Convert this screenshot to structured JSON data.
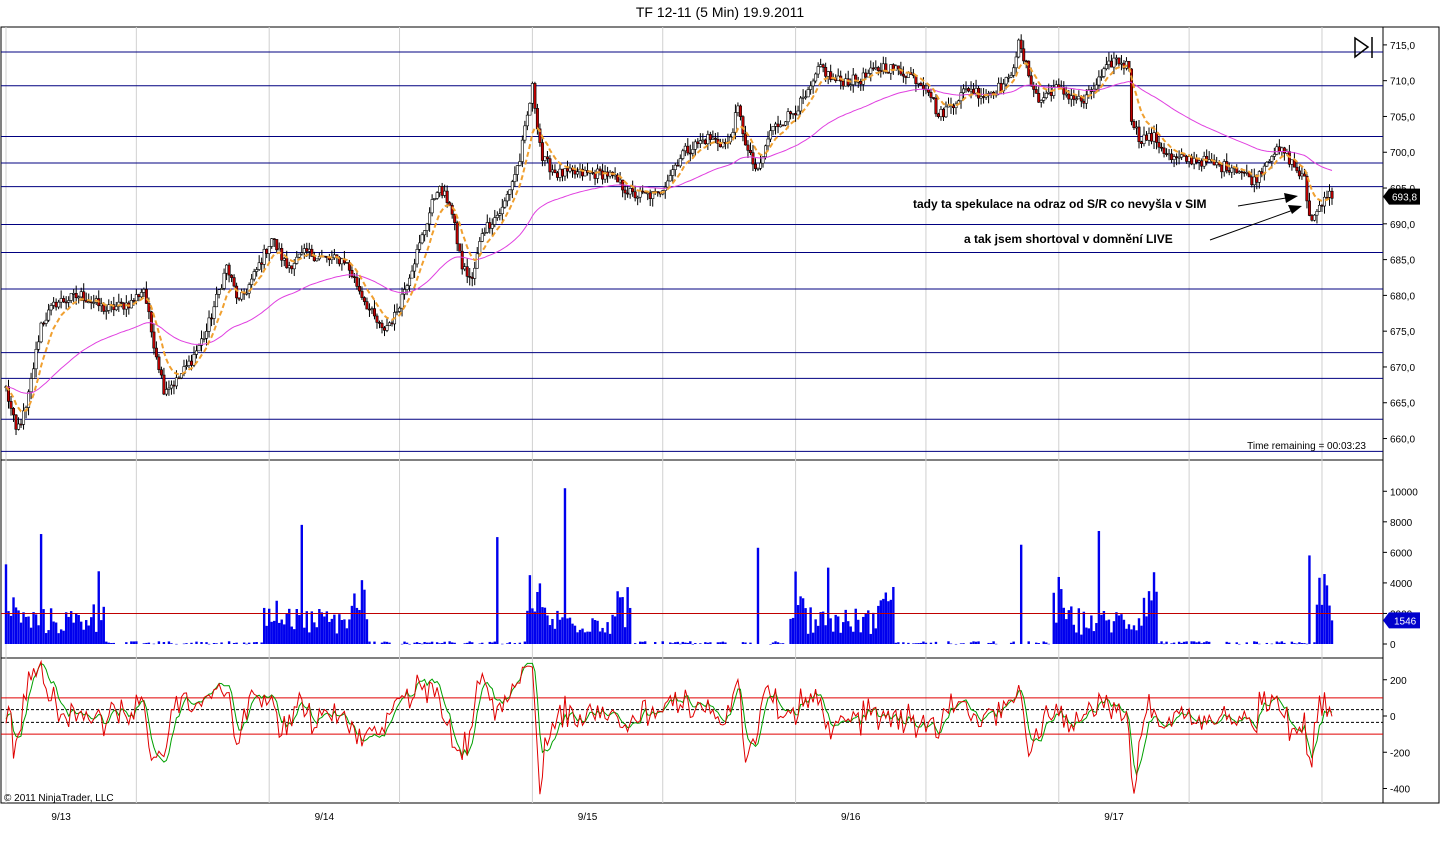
{
  "window": {
    "title": "TF 12-11 (5 Min)  19.9.2011"
  },
  "copyright": "© 2011 NinjaTrader, LLC",
  "time_remaining": "Time remaining = 00:03:23",
  "annotations": [
    "tady ta spekulace na odraz od S/R co nevyšla v SIM",
    "a tak jsem shortoval v domnění LIVE"
  ],
  "x_tick_labels": [
    "9/13",
    "9/14",
    "9/15",
    "9/16",
    "9/17"
  ],
  "colors": {
    "candle_up": "#ffffff",
    "candle_down": "#c00000",
    "ema_fast": "#f0a030",
    "sma_slow": "#e040e0",
    "volume": "#0000ee",
    "volume_level": "#c00000",
    "sr_line": "#000080",
    "osc_red": "#e00000",
    "osc_green": "#00a000",
    "price_marker": "#000000",
    "volume_marker": "#0000cc"
  },
  "chart_data": [
    {
      "type": "candlestick",
      "panel": "price",
      "y_tick_labels": [
        "715,0",
        "710,0",
        "705,0",
        "700,0",
        "695,0",
        "690,0",
        "685,0",
        "680,0",
        "675,0",
        "670,0",
        "665,0",
        "660,0"
      ],
      "y_ticks": [
        715,
        710,
        705,
        700,
        695,
        690,
        685,
        680,
        675,
        670,
        665,
        660
      ],
      "ylim": [
        657,
        717.5
      ],
      "last_price": 693.8,
      "last_price_label": "693,8",
      "sr_levels": [
        714.0,
        709.3,
        702.2,
        698.5,
        695.2,
        689.9,
        686.0,
        680.9,
        672.0,
        668.4,
        662.7,
        658.2
      ],
      "anchors": [
        [
          0,
          667
        ],
        [
          4,
          661
        ],
        [
          8,
          664
        ],
        [
          14,
          676
        ],
        [
          20,
          679
        ],
        [
          30,
          680
        ],
        [
          40,
          678
        ],
        [
          50,
          679
        ],
        [
          55,
          681
        ],
        [
          58,
          675
        ],
        [
          63,
          667
        ],
        [
          68,
          668
        ],
        [
          74,
          671
        ],
        [
          80,
          675
        ],
        [
          88,
          684
        ],
        [
          93,
          679
        ],
        [
          98,
          682
        ],
        [
          106,
          688
        ],
        [
          112,
          684
        ],
        [
          120,
          686
        ],
        [
          128,
          685
        ],
        [
          135,
          685
        ],
        [
          145,
          678
        ],
        [
          150,
          675
        ],
        [
          155,
          677
        ],
        [
          160,
          682
        ],
        [
          165,
          687
        ],
        [
          172,
          695
        ],
        [
          177,
          693
        ],
        [
          182,
          684
        ],
        [
          186,
          682
        ],
        [
          190,
          689
        ],
        [
          198,
          692
        ],
        [
          205,
          699
        ],
        [
          210,
          709
        ],
        [
          214,
          699
        ],
        [
          220,
          697
        ],
        [
          230,
          697
        ],
        [
          240,
          697
        ],
        [
          250,
          694
        ],
        [
          260,
          694
        ],
        [
          270,
          700
        ],
        [
          280,
          702
        ],
        [
          288,
          701
        ],
        [
          292,
          706
        ],
        [
          296,
          700
        ],
        [
          300,
          697
        ],
        [
          305,
          703
        ],
        [
          315,
          706
        ],
        [
          320,
          708
        ],
        [
          325,
          712
        ],
        [
          330,
          710
        ],
        [
          340,
          710
        ],
        [
          350,
          712
        ],
        [
          360,
          711
        ],
        [
          368,
          709
        ],
        [
          372,
          705
        ],
        [
          378,
          707
        ],
        [
          384,
          709
        ],
        [
          390,
          708
        ],
        [
          396,
          709
        ],
        [
          400,
          710
        ],
        [
          404,
          715
        ],
        [
          408,
          711
        ],
        [
          412,
          707
        ],
        [
          418,
          709
        ],
        [
          424,
          708
        ],
        [
          430,
          707
        ],
        [
          436,
          710
        ],
        [
          442,
          713
        ],
        [
          448,
          712
        ],
        [
          449,
          705
        ],
        [
          452,
          702
        ],
        [
          458,
          702
        ],
        [
          465,
          699
        ],
        [
          475,
          699
        ],
        [
          485,
          698
        ],
        [
          490,
          698
        ],
        [
          498,
          696
        ],
        [
          505,
          700
        ],
        [
          510,
          700
        ],
        [
          514,
          698
        ],
        [
          518,
          696
        ],
        [
          520,
          691
        ],
        [
          522,
          691
        ],
        [
          526,
          694
        ],
        [
          529,
          694
        ]
      ]
    },
    {
      "type": "bar",
      "panel": "volume",
      "y_tick_labels": [
        "10000",
        "8000",
        "6000",
        "4000",
        "2000",
        "0"
      ],
      "y_ticks": [
        10000,
        8000,
        6000,
        4000,
        2000,
        0
      ],
      "ylim": [
        0,
        11000
      ],
      "reference_level": 2000,
      "last_value": 1546,
      "last_value_label": "1546",
      "session_bars": [
        0,
        105,
        210,
        315,
        420,
        525
      ],
      "spikes": [
        [
          14,
          7200
        ],
        [
          118,
          7800
        ],
        [
          196,
          7000
        ],
        [
          223,
          10200
        ],
        [
          300,
          6300
        ],
        [
          328,
          5000
        ],
        [
          405,
          6500
        ],
        [
          436,
          7400
        ],
        [
          520,
          5800
        ]
      ]
    },
    {
      "type": "line",
      "panel": "oscillator",
      "y_tick_labels": [
        "200",
        "0",
        "-200",
        "-400"
      ],
      "y_ticks": [
        200,
        0,
        -200,
        -400
      ],
      "ylim": [
        -480,
        320
      ],
      "reference_levels": [
        100,
        -100
      ],
      "dashed_levels": [
        35,
        -35
      ],
      "series": []
    }
  ]
}
